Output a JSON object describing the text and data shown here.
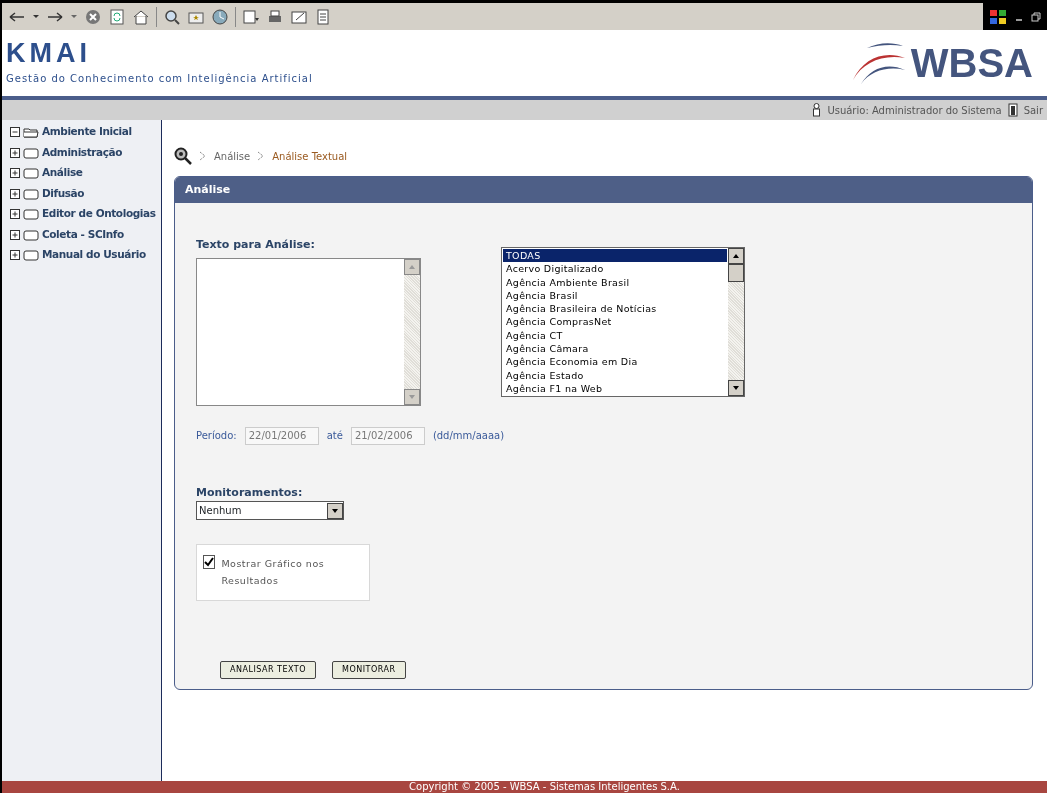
{
  "header": {
    "logo": "KMAI",
    "tagline": "Gestão do Conhecimento com Inteligência Artificial",
    "brand": "WBSA"
  },
  "user_bar": {
    "user": "Usuário: Administrador do Sistema",
    "logout": "Sair"
  },
  "sidebar": {
    "items": [
      {
        "label": "Ambiente Inicial",
        "expanded": true
      },
      {
        "label": "Administração",
        "expanded": false
      },
      {
        "label": "Análise",
        "expanded": false
      },
      {
        "label": "Difusão",
        "expanded": false
      },
      {
        "label": "Editor de Ontologias",
        "expanded": false
      },
      {
        "label": "Coleta - SCInfo",
        "expanded": false
      },
      {
        "label": "Manual do Usuário",
        "expanded": false
      }
    ]
  },
  "breadcrumb": [
    {
      "label": "Análise",
      "selected": false
    },
    {
      "label": "Análise Textual",
      "selected": true
    }
  ],
  "panel": {
    "title": "Análise",
    "text_label": "Texto para Análise:",
    "sources": [
      {
        "label": "TODAS",
        "selected": true
      },
      {
        "label": "Acervo Digitalizado",
        "selected": false
      },
      {
        "label": "Agência Ambiente Brasil",
        "selected": false
      },
      {
        "label": "Agência Brasil",
        "selected": false
      },
      {
        "label": "Agência Brasileira de Notícias",
        "selected": false
      },
      {
        "label": "Agência ComprasNet",
        "selected": false
      },
      {
        "label": "Agência CT",
        "selected": false
      },
      {
        "label": "Agência Câmara",
        "selected": false
      },
      {
        "label": "Agência Economia em Dia",
        "selected": false
      },
      {
        "label": "Agência Estado",
        "selected": false
      },
      {
        "label": "Agência F1 na Web",
        "selected": false
      }
    ],
    "period_label": "Período:",
    "date_from": "22/01/2006",
    "until_label": "até",
    "date_to": "21/02/2006",
    "date_format": "(dd/mm/aaaa)",
    "monitor_label": "Monitoramentos:",
    "monitor_value": "Nenhum",
    "show_chart": {
      "label": "Mostrar Gráfico nos Resultados",
      "checked": true
    },
    "buttons": [
      "ANALISAR TEXTO",
      "MONITORAR"
    ]
  },
  "footer": "Copyright © 2005 - WBSA - Sistemas Inteligentes S.A."
}
